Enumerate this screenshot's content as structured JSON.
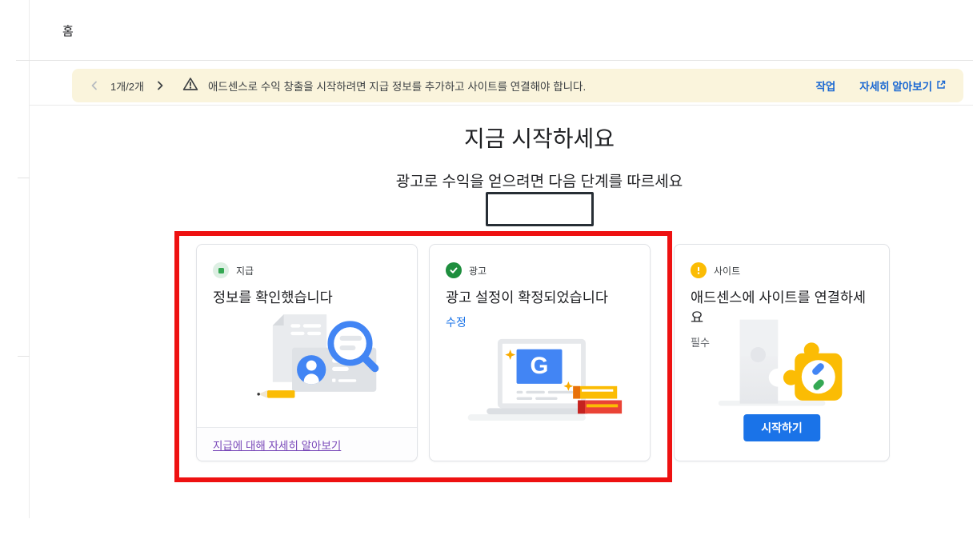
{
  "page": {
    "title": "홈"
  },
  "banner": {
    "pager_label": "1개/2개",
    "message": "애드센스로 수익 창출을 시작하려면 지급 정보를 추가하고 사이트를 연결해야 합니다.",
    "action_label": "작업",
    "learn_more_label": "자세히 알아보기"
  },
  "hero": {
    "title": "지금 시작하세요",
    "subtitle": "광고로 수익을 얻으려면 다음 단계를 따르세요"
  },
  "cards": [
    {
      "label": "지급",
      "title": "정보를 확인했습니다",
      "footer_link": "지급에 대해 자세히 알아보기",
      "status": "complete"
    },
    {
      "label": "광고",
      "title": "광고 설정이 확정되었습니다",
      "edit_link": "수정",
      "illustration_letter": "G",
      "status": "complete"
    },
    {
      "label": "사이트",
      "title": "애드센스에 사이트를 연결하세요",
      "required_label": "필수",
      "button_label": "시작하기",
      "status": "action-required"
    }
  ],
  "icons": {
    "chevron_left": "‹",
    "chevron_right": "›",
    "warning_triangle": "⚠",
    "external_link": "open-in-new",
    "payments_status": "green-square-in-light-circle",
    "ads_status": "green-check-circle",
    "sites_status": "yellow-exclamation-circle"
  },
  "colors": {
    "banner_bg": "#faf4dc",
    "link_blue": "#1a73e8",
    "visited_purple": "#7847b8",
    "success_green": "#1e8e3e",
    "warning_yellow": "#fbbc04",
    "annotation_red": "#ee1111",
    "annotation_box_border": "#272e35"
  }
}
